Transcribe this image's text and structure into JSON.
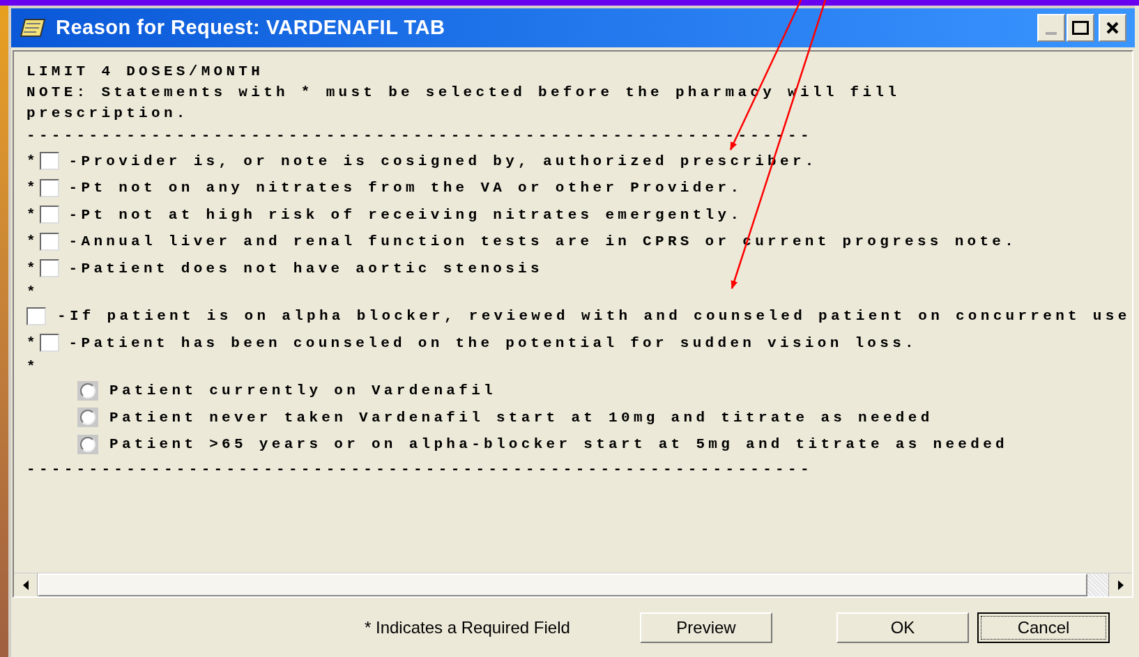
{
  "window": {
    "title": "Reason for Request: VARDENAFIL TAB"
  },
  "lines": [
    {
      "kind": "text",
      "text": "LIMIT 4 DOSES/MONTH"
    },
    {
      "kind": "text",
      "text": "NOTE: Statements with * must be selected before the pharmacy will fill"
    },
    {
      "kind": "text",
      "text": "prescription."
    },
    {
      "kind": "rule",
      "text": "---------------------------------------------------------------"
    },
    {
      "kind": "checkbox",
      "marker": "*",
      "text": "-Provider is, or note is cosigned by, authorized prescriber.",
      "checked": false
    },
    {
      "kind": "checkbox",
      "marker": "*",
      "text": "-Pt not on any nitrates from the VA or other Provider.",
      "checked": false
    },
    {
      "kind": "checkbox",
      "marker": "*",
      "text": "-Pt not at high risk of receiving nitrates emergently.",
      "checked": false
    },
    {
      "kind": "checkbox",
      "marker": "*",
      "text": "-Annual liver and renal function tests are in CPRS or current progress note.",
      "checked": false
    },
    {
      "kind": "checkbox",
      "marker": "*",
      "text": "-Patient does not have aortic stenosis",
      "checked": false
    },
    {
      "kind": "text",
      "text": "*"
    },
    {
      "kind": "checkbox",
      "text": "-If patient is on alpha blocker, reviewed with and counseled patient on concurrent use",
      "checked": false
    },
    {
      "kind": "checkbox",
      "marker": "*",
      "text": "-Patient has been counseled on the potential for sudden vision loss.",
      "checked": false
    },
    {
      "kind": "text",
      "text": "*"
    },
    {
      "kind": "radio",
      "text": "Patient currently on Vardenafil",
      "selected": false
    },
    {
      "kind": "radio",
      "text": "Patient never taken Vardenafil start at 10mg and titrate as needed",
      "selected": false
    },
    {
      "kind": "radio",
      "text": "Patient >65 years or on alpha-blocker start at 5mg and titrate as needed",
      "selected": false
    },
    {
      "kind": "rule",
      "text": "---------------------------------------------------------------"
    }
  ],
  "footer": {
    "note": "* Indicates a Required Field",
    "buttons": [
      {
        "label": "Preview",
        "default": false
      },
      {
        "label": "OK",
        "default": false
      },
      {
        "label": "Cancel",
        "default": true
      }
    ]
  }
}
